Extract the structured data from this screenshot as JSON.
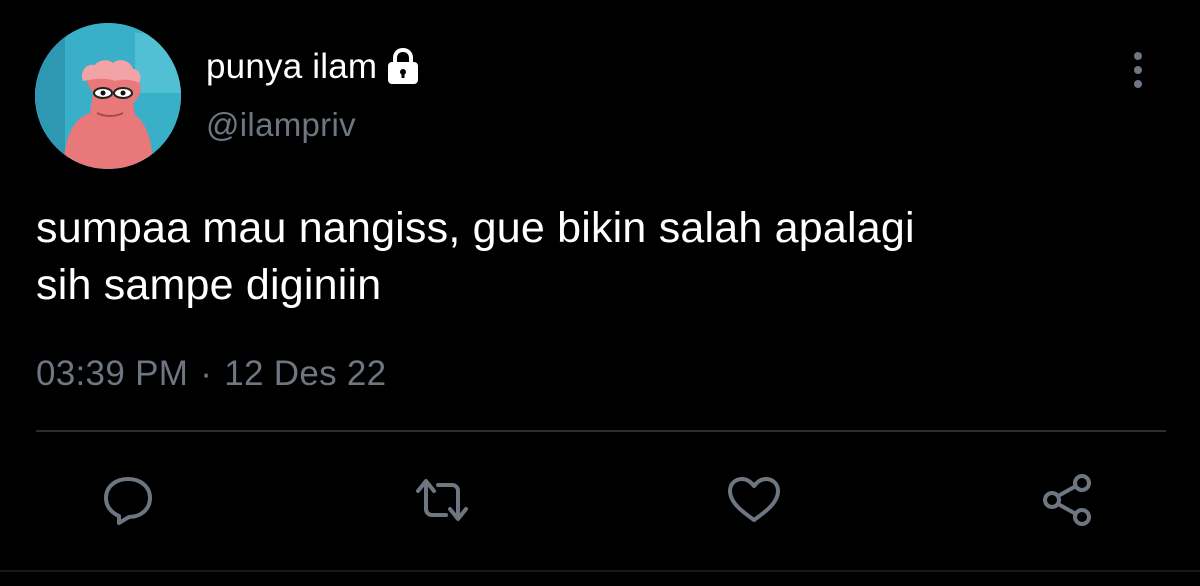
{
  "user": {
    "display_name": "punya ilam",
    "handle": "@ilampriv",
    "protected_icon": "lock-icon",
    "avatar_icon": "avatar-image"
  },
  "tweet": {
    "text_line1": "sumpaa mau nangiss, gue bikin salah apalagi",
    "text_line2": "sih sampe diginiin",
    "time": "03:39 PM",
    "separator": "·",
    "date": "12 Des 22"
  },
  "actions": [
    {
      "name": "reply",
      "icon": "comment-icon"
    },
    {
      "name": "retweet",
      "icon": "retweet-icon"
    },
    {
      "name": "like",
      "icon": "heart-icon"
    },
    {
      "name": "share",
      "icon": "share-icon"
    }
  ],
  "colors": {
    "background": "#000000",
    "primary_text": "#ffffff",
    "secondary_text": "#6e7681",
    "divider": "#2a2d31"
  }
}
